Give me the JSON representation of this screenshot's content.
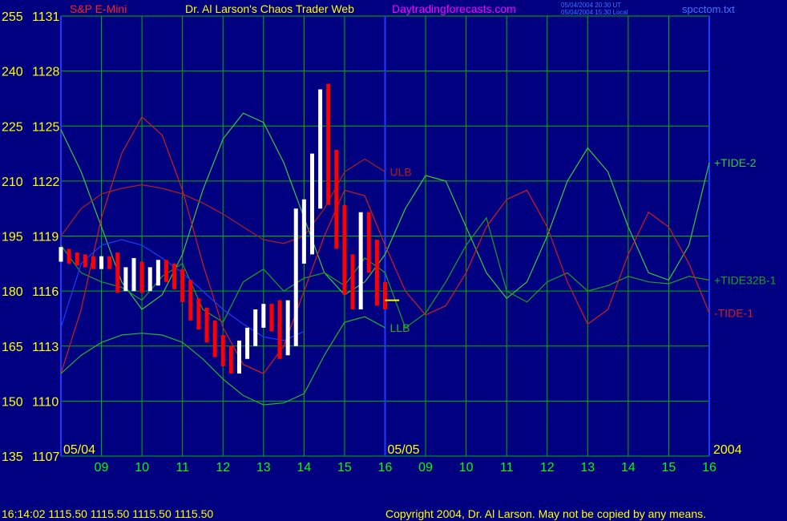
{
  "header": {
    "instrument": "S&P E-Mini",
    "site_title": "Dr. Al Larson's Chaos Trader Web",
    "site_url": "Daytradingforecasts.com",
    "timestamp_ut": "05/04/2004 20:30 UT",
    "timestamp_local": "05/04/2004 15:30 Local",
    "filename": "spcctom.txt"
  },
  "footer": {
    "quote": "16:14:02  1115.50 1115.50 1115.50 1115.50",
    "copyright": "Copyright 2004, Dr. Al Larson. May not be copied by any means."
  },
  "colors": {
    "background": "#000080",
    "grid": "#00b400",
    "price_up": "#ffffff",
    "price_down": "#ff0000",
    "tide2": "#3cc83c",
    "tide32": "#1ea01e",
    "tide1": "#d21e1e",
    "ulb": "#b41e1e",
    "llb": "#28b428",
    "blue_curve": "#1e3cff",
    "axis_text": "#ffff00",
    "time_text": "#00ff00",
    "title_text": "#ffff00",
    "url_text": "#ff00ff",
    "instrument_text": "#ff2020",
    "timestamp_text": "#3c78ff",
    "forecast_marker": "#ffff00"
  },
  "chart_data": {
    "type": "line",
    "title": "S&P E-Mini",
    "y_axis": {
      "left_scale": [
        255,
        240,
        225,
        210,
        195,
        180,
        165,
        150,
        135
      ],
      "price_scale": [
        1131,
        1128,
        1125,
        1122,
        1119,
        1116,
        1113,
        1110,
        1107
      ],
      "ylim": [
        1107,
        1131
      ]
    },
    "x_axis": {
      "hours": [
        "09",
        "10",
        "11",
        "12",
        "13",
        "14",
        "15",
        "16",
        "09",
        "10",
        "11",
        "12",
        "13",
        "14",
        "15",
        "16"
      ],
      "hour_x": [
        8.5,
        9.5,
        10.5,
        11.5,
        12.5,
        13.5,
        14.5,
        15.5,
        16.5,
        17.5,
        18.5,
        19.5,
        20.5,
        21.5,
        22.5,
        23.5
      ],
      "date_labels": [
        {
          "label": "05/04",
          "x": 7.5
        },
        {
          "label": "05/05",
          "x": 15.5
        }
      ],
      "year_label": "2004",
      "xlim": [
        7.5,
        23.5
      ]
    },
    "series": [
      {
        "name": "+TIDE-2",
        "color_key": "tide2",
        "x": [
          7.5,
          8.0,
          8.5,
          9.0,
          9.5,
          10.0,
          10.5,
          11.0,
          11.5,
          12.0,
          12.5,
          13.0,
          13.5,
          14.0,
          14.5,
          15.0,
          15.5,
          16.0,
          16.5,
          17.0,
          17.5,
          18.0,
          18.5,
          19.0,
          19.5,
          20.0,
          20.5,
          21.0,
          21.5,
          22.0,
          22.5,
          23.0,
          23.5
        ],
        "y": [
          1124.8,
          1122.5,
          1119.5,
          1116.5,
          1115.0,
          1115.8,
          1118.0,
          1121.5,
          1124.3,
          1125.7,
          1125.2,
          1123.0,
          1120.0,
          1117.0,
          1115.8,
          1116.5,
          1118.0,
          1120.5,
          1122.3,
          1122.0,
          1119.5,
          1117.0,
          1115.6,
          1116.5,
          1119.0,
          1122.0,
          1123.8,
          1122.5,
          1119.5,
          1117.0,
          1116.6,
          1118.5,
          1123.0
        ]
      },
      {
        "name": "+TIDE32B-1",
        "color_key": "tide32",
        "x": [
          7.5,
          8.0,
          8.5,
          9.0,
          9.5,
          10.0,
          10.5,
          11.0,
          11.5,
          12.0,
          12.5,
          13.0,
          13.5,
          14.0,
          14.5,
          15.0,
          15.5,
          16.0,
          16.5,
          17.0,
          17.5,
          18.0,
          18.5,
          19.0,
          19.5,
          20.0,
          20.5,
          21.0,
          21.5,
          22.0,
          22.5,
          23.0,
          23.5
        ],
        "y": [
          1118.5,
          1117.0,
          1116.5,
          1116.2,
          1115.5,
          1116.8,
          1117.5,
          1115.0,
          1114.3,
          1116.5,
          1117.2,
          1116.0,
          1116.7,
          1117.0,
          1116.3,
          1117.8,
          1117.0,
          1114.0,
          1114.8,
          1116.5,
          1118.5,
          1120.0,
          1116.0,
          1115.4,
          1116.5,
          1117.0,
          1116.0,
          1116.3,
          1116.8,
          1116.5,
          1116.4,
          1116.8,
          1116.6
        ]
      },
      {
        "name": "-TIDE-1",
        "color_key": "tide1",
        "x": [
          7.5,
          8.0,
          8.5,
          9.0,
          9.5,
          10.0,
          10.5,
          11.0,
          11.5,
          12.0,
          12.5,
          13.0,
          13.5,
          14.0,
          14.5,
          15.0,
          15.5,
          16.0,
          16.5,
          17.0,
          17.5,
          18.0,
          18.5,
          19.0,
          19.5,
          20.0,
          20.5,
          21.0,
          21.5,
          22.0,
          22.5,
          23.0,
          23.5
        ],
        "y": [
          1111.5,
          1115.0,
          1120.0,
          1123.5,
          1125.5,
          1124.5,
          1121.5,
          1117.5,
          1114.0,
          1112.0,
          1111.5,
          1113.0,
          1116.0,
          1119.0,
          1121.5,
          1121.2,
          1118.5,
          1116.0,
          1114.7,
          1115.2,
          1117.0,
          1119.5,
          1121.0,
          1121.5,
          1119.5,
          1116.5,
          1114.2,
          1115.0,
          1118.0,
          1120.3,
          1119.5,
          1117.5,
          1114.8
        ]
      },
      {
        "name": "ULB",
        "color_key": "ulb",
        "x": [
          7.5,
          8.0,
          8.5,
          9.0,
          9.5,
          10.0,
          10.5,
          11.0,
          11.5,
          12.0,
          12.5,
          13.0,
          13.5,
          14.0,
          14.5,
          15.0,
          15.5
        ],
        "y": [
          1119.0,
          1120.5,
          1121.3,
          1121.6,
          1121.8,
          1121.6,
          1121.3,
          1120.8,
          1120.2,
          1119.5,
          1118.8,
          1118.6,
          1119.0,
          1120.5,
          1122.5,
          1123.2,
          1122.5
        ]
      },
      {
        "name": "LLB",
        "color_key": "llb",
        "x": [
          7.5,
          8.0,
          8.5,
          9.0,
          9.5,
          10.0,
          10.5,
          11.0,
          11.5,
          12.0,
          12.5,
          13.0,
          13.5,
          14.0,
          14.5,
          15.0,
          15.5
        ],
        "y": [
          1111.5,
          1112.5,
          1113.2,
          1113.6,
          1113.7,
          1113.6,
          1113.2,
          1112.3,
          1111.2,
          1110.3,
          1109.8,
          1109.9,
          1110.4,
          1112.5,
          1114.3,
          1114.6,
          1114.0
        ]
      },
      {
        "name": "",
        "color_key": "blue_curve",
        "x": [
          7.5,
          8.0,
          8.5,
          9.0,
          9.5,
          10.0,
          10.5,
          11.0,
          11.5,
          12.0,
          12.5,
          13.0,
          13.5
        ],
        "y": [
          1114.0,
          1117.5,
          1118.5,
          1118.8,
          1118.5,
          1117.8,
          1117.0,
          1116.0,
          1115.0,
          1114.2,
          1113.5,
          1113.3,
          1113.8
        ]
      }
    ],
    "price": {
      "x": [
        7.5,
        7.7,
        7.9,
        8.1,
        8.3,
        8.5,
        8.7,
        8.9,
        9.1,
        9.3,
        9.5,
        9.7,
        9.9,
        10.1,
        10.3,
        10.5,
        10.7,
        10.9,
        11.1,
        11.3,
        11.5,
        11.7,
        11.9,
        12.1,
        12.3,
        12.5,
        12.7,
        12.9,
        13.1,
        13.3,
        13.5,
        13.7,
        13.9,
        14.1,
        14.3,
        14.5,
        14.7,
        14.9,
        15.1,
        15.3,
        15.5
      ],
      "y": [
        1118.0,
        1117.8,
        1117.7,
        1117.6,
        1117.5,
        1117.6,
        1117.5,
        1116.5,
        1116.8,
        1117.0,
        1116.5,
        1116.8,
        1117.2,
        1117.0,
        1116.6,
        1116.0,
        1115.0,
        1114.5,
        1113.8,
        1113.0,
        1112.5,
        1112.0,
        1112.8,
        1113.5,
        1114.5,
        1114.8,
        1114.3,
        1113.5,
        1114.5,
        1119.0,
        1119.5,
        1122.0,
        1125.5,
        1122.5,
        1119.5,
        1117.0,
        1116.0,
        1119.3,
        1118.0,
        1116.0,
        1115.5
      ],
      "wick": [
        0.4,
        0.3,
        0.3,
        0.3,
        0.3,
        0.3,
        0.3,
        0.6,
        0.5,
        0.8,
        0.6,
        0.5,
        0.5,
        0.5,
        0.5,
        0.6,
        0.6,
        0.6,
        0.6,
        0.6,
        0.6,
        0.5,
        0.5,
        0.5,
        0.5,
        0.5,
        0.5,
        1.2,
        1.0,
        1.5,
        1.5,
        1.5,
        1.5,
        1.8,
        1.2,
        1.2,
        1.0,
        1.0,
        1.0,
        0.8,
        0.5
      ],
      "forecast_marker": {
        "x0": 15.5,
        "x1": 15.85,
        "y": 1115.5
      }
    }
  }
}
